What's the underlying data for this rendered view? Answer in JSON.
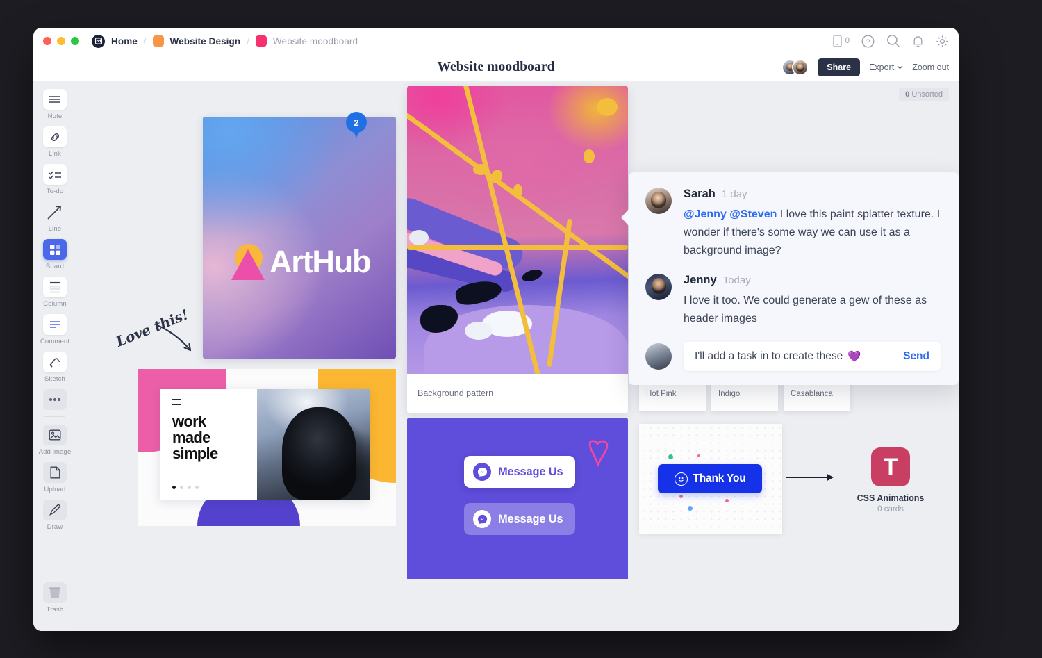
{
  "titlebar": {
    "breadcrumbs": [
      {
        "label": "Home",
        "icon": "milanote-logo-icon",
        "swatch": ""
      },
      {
        "label": "Website Design",
        "icon": "board-swatch-icon",
        "swatch": "#f79548"
      },
      {
        "label": "Website moodboard",
        "icon": "board-swatch-icon",
        "swatch": "#f7316f"
      }
    ],
    "separator": "/",
    "mobile_count": "0",
    "icons": [
      "mobile-icon",
      "help-icon",
      "search-icon",
      "bell-icon",
      "gear-icon"
    ]
  },
  "header": {
    "title": "Website moodboard",
    "share_label": "Share",
    "export_label": "Export",
    "zoom_label": "Zoom out"
  },
  "sidebar": {
    "items": [
      {
        "label": "Note",
        "icon": "note-icon",
        "style": "card",
        "active": false
      },
      {
        "label": "Link",
        "icon": "link-icon",
        "style": "card",
        "active": false
      },
      {
        "label": "To-do",
        "icon": "todo-icon",
        "style": "card",
        "active": false
      },
      {
        "label": "Line",
        "icon": "arrow-line-icon",
        "style": "bare",
        "active": false
      },
      {
        "label": "Board",
        "icon": "board-grid-icon",
        "style": "active",
        "active": true
      },
      {
        "label": "Column",
        "icon": "column-icon",
        "style": "card",
        "active": false
      },
      {
        "label": "Comment",
        "icon": "comment-icon",
        "style": "card",
        "active": false
      },
      {
        "label": "Sketch",
        "icon": "sketch-icon",
        "style": "card",
        "active": false
      },
      {
        "label": "",
        "icon": "more-dots-icon",
        "style": "flat",
        "active": false
      },
      {
        "label": "Add image",
        "icon": "image-icon",
        "style": "flat",
        "active": false
      },
      {
        "label": "Upload",
        "icon": "file-upload-icon",
        "style": "flat",
        "active": false
      },
      {
        "label": "Draw",
        "icon": "pencil-icon",
        "style": "flat",
        "active": false
      }
    ],
    "trash": {
      "label": "Trash",
      "icon": "trash-icon"
    }
  },
  "canvas": {
    "unsorted_count": "0",
    "unsorted_label": "Unsorted",
    "arthub": {
      "brand": "ArtHub",
      "icon": "arthub-logo-icon"
    },
    "annotation": {
      "text": "Love this!",
      "icon": "handwritten-arrow-icon"
    },
    "work_card": {
      "headline": "work\nmade\nsimple",
      "dots": 4,
      "active_dot": 1,
      "menu_icon": "hamburger-icon"
    },
    "splatter": {
      "caption": "Background pattern",
      "pin_count": "2"
    },
    "messenger": {
      "buttons": [
        {
          "label": "Message Us",
          "variant": "light",
          "icon": "messenger-icon"
        },
        {
          "label": "Message Us",
          "variant": "translucent",
          "icon": "messenger-icon"
        }
      ],
      "doodle": "heart-doodle-icon"
    },
    "swatches": [
      {
        "name": "Hot Pink",
        "color": "#f0369f"
      },
      {
        "name": "Indigo",
        "color": "#4237c4"
      },
      {
        "name": "Casablanca",
        "color": "#eeac33"
      }
    ],
    "thank_you": {
      "label": "Thank You",
      "icon": "smiley-icon",
      "color": "#1632e8"
    },
    "linked_board": {
      "initial": "T",
      "name": "CSS Animations",
      "cards": "0 cards",
      "color": "#c93e63"
    }
  },
  "comments": {
    "threads": [
      {
        "author": "Sarah",
        "time": "1 day",
        "mentions": "@Jenny @Steven",
        "body": " I love this paint splatter texture. I wonder if there's some way we can use it as a background image?"
      },
      {
        "author": "Jenny",
        "time": "Today",
        "mentions": "",
        "body": "I love it too. We could generate a gew of these as header images"
      }
    ],
    "reply": {
      "value": "I'll add a task in to create these",
      "emoji": "💜",
      "send_label": "Send"
    }
  }
}
